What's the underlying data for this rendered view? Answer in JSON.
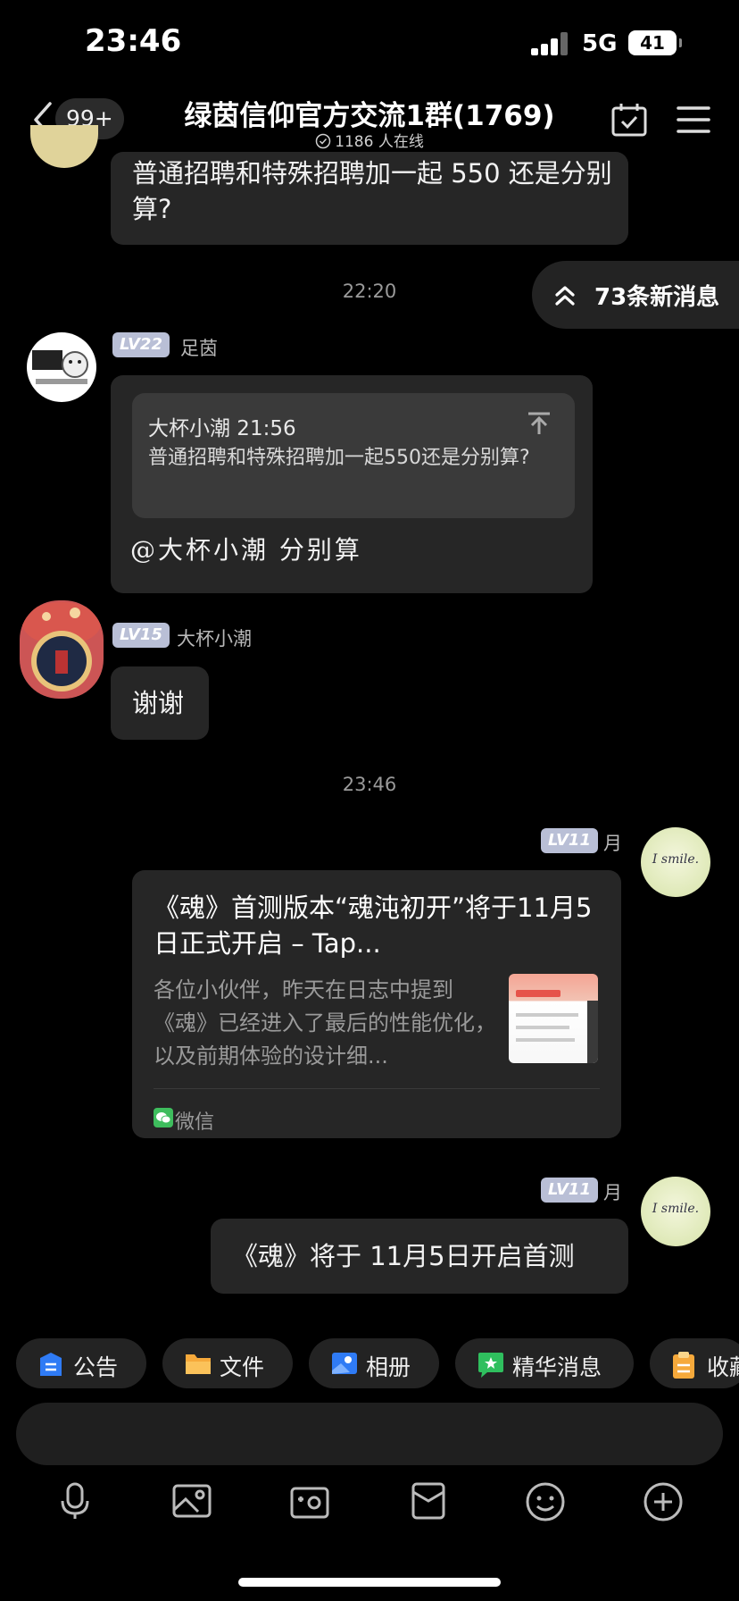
{
  "status_bar": {
    "time": "23:46",
    "network": "5G",
    "battery": "41"
  },
  "header": {
    "unread_badge": "99+",
    "group_title": "绿茵信仰官方交流1群(1769)",
    "online_text": "1186 人在线"
  },
  "messages": {
    "m1_text": "普通招聘和特殊招聘加一起 550 还是分别算?",
    "time1": "22:20",
    "new_messages": "73条新消息",
    "m2": {
      "level": "LV22",
      "name": "足茵",
      "quote_sender_time": "大杯小潮 21:56",
      "quote_text": "普通招聘和特殊招聘加一起550还是分别算?",
      "reply_text": "@大杯小潮 分别算"
    },
    "m3": {
      "level": "LV15",
      "name": "大杯小潮",
      "text": "谢谢"
    },
    "time2": "23:46",
    "m4": {
      "level": "LV11",
      "name": "月",
      "card_title": "《魂》首测版本“魂沌初开”将于11月5日正式开启 – Tap...",
      "card_desc": "各位小伙伴，昨天在日志中提到《魂》已经进入了最后的性能优化，以及前期体验的设计细...",
      "card_source": "微信"
    },
    "m5": {
      "level": "LV11",
      "name": "月",
      "text": "《魂》将于 11月5日开启首测"
    },
    "avatar_text": "I smile."
  },
  "chips": [
    "公告",
    "文件",
    "相册",
    "精华消息",
    "收藏"
  ],
  "icons": [
    "back-icon",
    "calendar-check-icon",
    "menu-icon",
    "chevron-up-double-icon",
    "reply-top-icon",
    "announcement-icon",
    "folder-icon",
    "album-icon",
    "highlight-icon",
    "collect-icon",
    "mic-icon",
    "image-icon",
    "camera-icon",
    "red-packet-icon",
    "emoji-icon",
    "plus-icon"
  ]
}
